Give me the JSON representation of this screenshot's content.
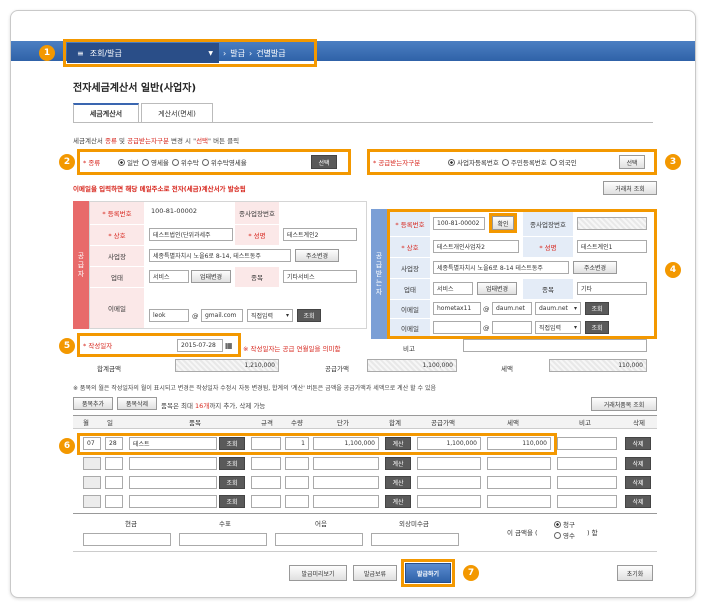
{
  "menu": {
    "main_label": "조회/발급",
    "crumb1": "발급",
    "crumb2": "건별발급"
  },
  "badges": [
    "1",
    "2",
    "3",
    "4",
    "5",
    "6",
    "7"
  ],
  "page_title": "전자세금계산서 일반(사업자)",
  "tabs": [
    {
      "label": "세금계산서",
      "active": true
    },
    {
      "label": "계산서(면세)",
      "active": false
    }
  ],
  "notice1": {
    "a": "세금계산서 ",
    "b": "종류",
    "c": " 및 ",
    "d": "공급받는자구분",
    "e": " 변경 시 \"",
    "f": "선택",
    "g": "\" 버튼 클릭"
  },
  "kind": {
    "label": "* 종류",
    "options": [
      "일반",
      "영세율",
      "위수탁",
      "위수탁영세율"
    ],
    "selected": 0,
    "select_btn": "선택"
  },
  "recipient_type": {
    "label": "* 공급받는자구분",
    "options": [
      "사업자등록번호",
      "주민등록번호",
      "외국인"
    ],
    "selected": 0,
    "select_btn": "선택"
  },
  "notice2": "이메일을 입력하면 해당 메일주소로 전자(세금)계산서가 발송됨",
  "buyer_lookup_btn": "거래처 조회",
  "supplier": {
    "side_label": "공급자",
    "reg_no_label": "* 등록번호",
    "reg_no": "100-81-00002",
    "branch_no_label": "종사업장번호",
    "name_label": "* 상호",
    "name": "테스트법인(단위과세주",
    "ceo_label": "* 성명",
    "ceo": "테스트계인2",
    "addr_label": "사업장",
    "addr": "세종특별자치시 노을6로 8-14, 테스트동주",
    "addr_btn": "주소변경",
    "biz_label": "업태",
    "biz": "서비스",
    "biz_btn": "업태변경",
    "item_label": "종목",
    "item": "기타서비스",
    "email_label": "이메일",
    "email_id": "leok",
    "email_domain": "gmail.com",
    "email_select": "직접입력",
    "email_btn": "조회"
  },
  "recipient": {
    "side_label": "공급받는자",
    "reg_no_label": "* 등록번호",
    "reg_no": "100-81-00002",
    "confirm_btn": "확인",
    "branch_no_label": "종사업장번호",
    "name_label": "* 상호",
    "name": "테스트개인사업자2",
    "ceo_label": "* 성명",
    "ceo": "테스트계인1",
    "addr_label": "사업장",
    "addr": "세종특별자치시 노을6로 8-14 테스트동주",
    "addr_btn": "주소변경",
    "biz_label": "업태",
    "biz": "서비스",
    "biz_btn": "업태변경",
    "item_label": "종목",
    "item": "기타",
    "email1_label": "이메일",
    "email1_id": "hometax11",
    "email1_domain": "daum.net",
    "email1_select": "daum.net",
    "email1_btn": "조회",
    "email2_label": "이메일",
    "email2_id": "",
    "email2_domain": "",
    "email2_select": "직접입력",
    "email2_btn": "조회"
  },
  "write_date": {
    "label": "* 작성일자",
    "value": "2015-07-28",
    "hint": "※ 작성일자는 공급 연월일을 의미함",
    "memo_label": "비고"
  },
  "totals": {
    "total_label": "합계금액",
    "total": "1,210,000",
    "supply_label": "공급가액",
    "supply": "1,100,000",
    "tax_label": "세액",
    "tax": "110,000"
  },
  "notice3": "※ 품목의 월은 작성일자의 월이 표시되고 변경은 작성일자 수정시 자동 변경됨, 합계의 '계산' 버튼은 금액을 공급가액과 세액으로 계산 할 수 있음",
  "item_controls": {
    "add_btn": "품목추가",
    "del_btn": "품목삭제",
    "hint_a": "품목은 최대 ",
    "hint_b": "16개",
    "hint_c": "까지 추가, 삭제 가능",
    "lookup_btn": "거래처품목 조회"
  },
  "item_table": {
    "headers": [
      "월",
      "일",
      "품목",
      "규격",
      "수량",
      "단가",
      "합계",
      "공급가액",
      "세액",
      "비고",
      "삭제"
    ],
    "rows": [
      {
        "month": "07",
        "day": "28",
        "item": "테스트",
        "spec": "",
        "qty": "1",
        "price": "1,100,000",
        "supply": "1,100,000",
        "tax": "110,000",
        "memo": ""
      },
      {
        "month": "",
        "day": "",
        "item": "",
        "spec": "",
        "qty": "",
        "price": "",
        "supply": "",
        "tax": "",
        "memo": ""
      },
      {
        "month": "",
        "day": "",
        "item": "",
        "spec": "",
        "qty": "",
        "price": "",
        "supply": "",
        "tax": "",
        "memo": ""
      },
      {
        "month": "",
        "day": "",
        "item": "",
        "spec": "",
        "qty": "",
        "price": "",
        "supply": "",
        "tax": "",
        "memo": ""
      }
    ],
    "lookup_btn": "조회",
    "calc_btn": "계산",
    "delete_btn": "삭제"
  },
  "payment": {
    "headers": [
      "현금",
      "수표",
      "어음",
      "외상미수금"
    ],
    "claim_a": "이 금액을 (",
    "claim_opt1": "청구",
    "claim_opt2": "영수",
    "claim_b": ") 함"
  },
  "footer": {
    "preview_btn": "발급미리보기",
    "hold_btn": "발급보류",
    "issue_btn": "발급하기",
    "reset_btn": "초기화"
  },
  "colors": {
    "accent": "#f39800",
    "topbar": "#3a6db5",
    "red": "#d7261d",
    "supplier": "#e86a6a",
    "recipient": "#7b9fd6"
  }
}
